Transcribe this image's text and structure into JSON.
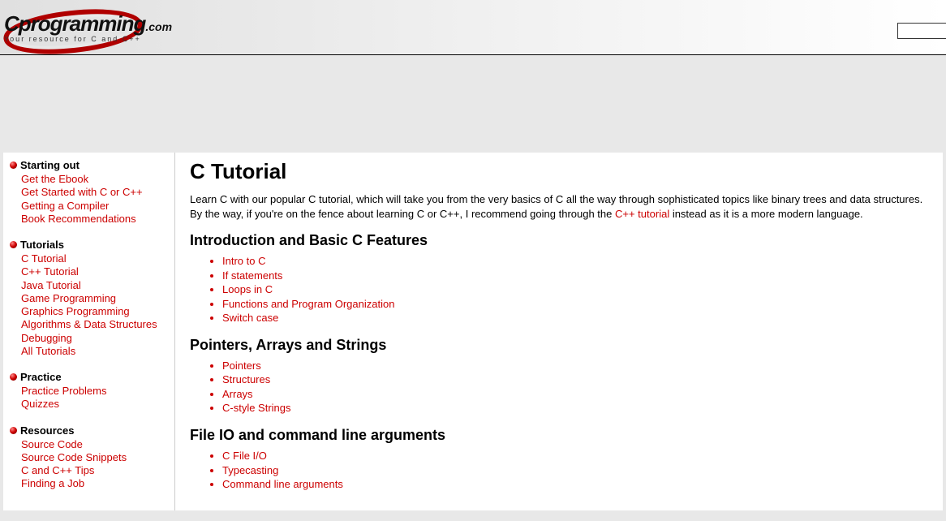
{
  "logo": {
    "main": "Cprogramming",
    "suffix": ".com",
    "tagline": "Your resource for   C and C++"
  },
  "sidebar": {
    "sections": [
      {
        "title": "Starting out",
        "items": [
          "Get the Ebook",
          "Get Started with C or C++",
          "Getting a Compiler",
          "Book Recommendations"
        ]
      },
      {
        "title": "Tutorials",
        "items": [
          "C Tutorial",
          "C++ Tutorial",
          "Java Tutorial",
          "Game Programming",
          "Graphics Programming",
          "Algorithms & Data Structures",
          "Debugging",
          "All Tutorials"
        ]
      },
      {
        "title": "Practice",
        "items": [
          "Practice Problems",
          "Quizzes"
        ]
      },
      {
        "title": "Resources",
        "items": [
          "Source Code",
          "Source Code Snippets",
          "C and C++ Tips",
          "Finding a Job"
        ]
      }
    ]
  },
  "main": {
    "title": "C Tutorial",
    "intro_1": "Learn C with our popular C tutorial, which will take you from the very basics of C all the way through sophisticated topics like binary trees and data structures. By the way, if you're on the fence about learning C or C++, I recommend going through the ",
    "intro_link": "C++ tutorial",
    "intro_2": " instead as it is a more modern language.",
    "sections": [
      {
        "heading": "Introduction and Basic C Features",
        "items": [
          "Intro to C",
          "If statements",
          "Loops in C",
          "Functions and Program Organization",
          "Switch case"
        ]
      },
      {
        "heading": "Pointers, Arrays and Strings",
        "items": [
          "Pointers",
          "Structures",
          "Arrays",
          "C-style Strings"
        ]
      },
      {
        "heading": "File IO and command line arguments",
        "items": [
          "C File I/O",
          "Typecasting",
          "Command line arguments"
        ]
      }
    ]
  }
}
